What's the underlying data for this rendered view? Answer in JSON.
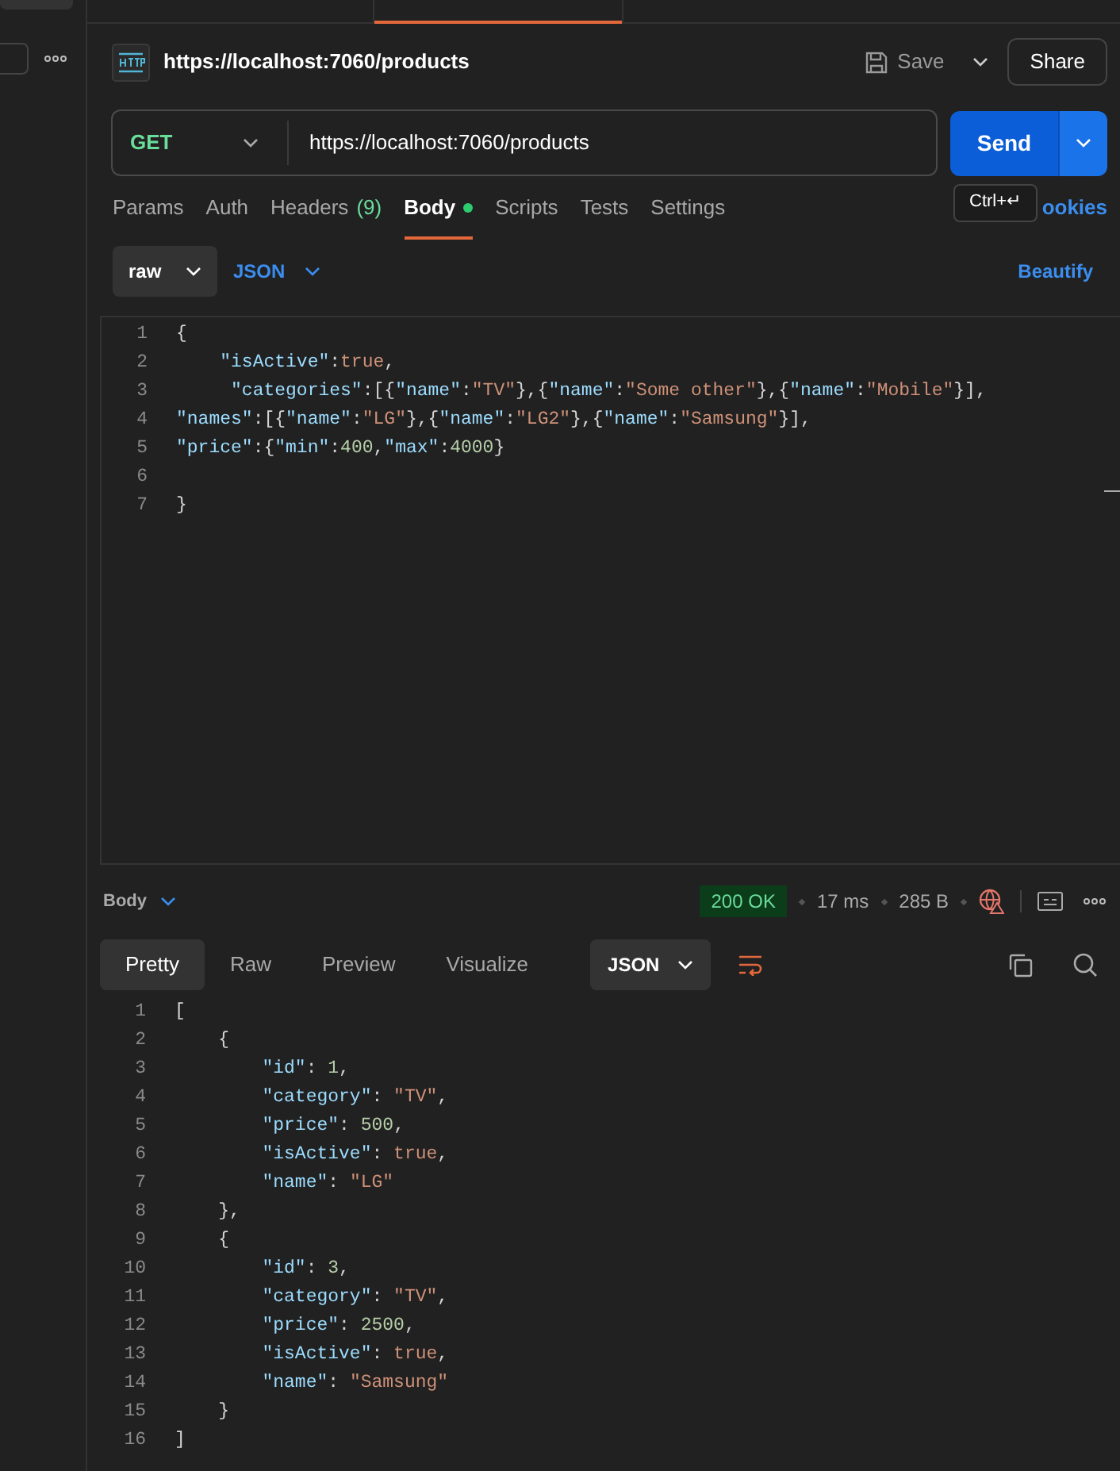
{
  "request": {
    "title": "https://localhost:7060/products",
    "save": "Save",
    "share": "Share",
    "method": "GET",
    "url": "https://localhost:7060/products",
    "send": "Send",
    "tooltip": "Ctrl+↵"
  },
  "tabs": [
    {
      "label": "Params",
      "selected": false
    },
    {
      "label": "Auth",
      "selected": false
    },
    {
      "label": "Headers",
      "count": "(9)",
      "selected": false
    },
    {
      "label": "Body",
      "selected": true,
      "modified": true
    },
    {
      "label": "Scripts",
      "selected": false
    },
    {
      "label": "Tests",
      "selected": false
    },
    {
      "label": "Settings",
      "selected": false
    }
  ],
  "cookies_link": "ookies",
  "body_mode": "raw",
  "body_language": "JSON",
  "beautify": "Beautify",
  "request_body": [
    {
      "number": "1",
      "code": "{"
    },
    {
      "number": "2",
      "code": "    \"isActive\":true,"
    },
    {
      "number": "3",
      "code": "     \"categories\":[{\"name\":\"TV\"},{\"name\":\"Some other\"},{\"name\":\"Mobile\"}],"
    },
    {
      "number": "4",
      "code": "\"names\":[{\"name\":\"LG\"},{\"name\":\"LG2\"},{\"name\":\"Samsung\"}],"
    },
    {
      "number": "5",
      "code": "\"price\":{\"min\":400,\"max\":4000}"
    },
    {
      "number": "6"
    },
    {
      "number": "7",
      "code": "}"
    }
  ],
  "response": {
    "section": "Body",
    "status": "200 OK",
    "time": "17 ms",
    "size": "285 B",
    "views": [
      {
        "label": "Pretty",
        "selected": true
      },
      {
        "label": "Raw",
        "selected": false
      },
      {
        "label": "Preview",
        "selected": false
      },
      {
        "label": "Visualize",
        "selected": false
      }
    ],
    "format": "JSON",
    "lines": [
      {
        "number": "1",
        "code": "["
      },
      {
        "number": "2",
        "code": "    {"
      },
      {
        "number": "3",
        "code": "        \"id\": 1,"
      },
      {
        "number": "4",
        "code": "        \"category\": \"TV\","
      },
      {
        "number": "5",
        "code": "        \"price\": 500,"
      },
      {
        "number": "6",
        "code": "        \"isActive\": true,"
      },
      {
        "number": "7",
        "code": "        \"name\": \"LG\""
      },
      {
        "number": "8",
        "code": "    },"
      },
      {
        "number": "9",
        "code": "    {"
      },
      {
        "number": "10",
        "code": "        \"id\": 3,"
      },
      {
        "number": "11",
        "code": "        \"category\": \"TV\","
      },
      {
        "number": "12",
        "code": "        \"price\": 2500,"
      },
      {
        "number": "13",
        "code": "        \"isActive\": true,"
      },
      {
        "number": "14",
        "code": "        \"name\": \"Samsung\""
      },
      {
        "number": "15",
        "code": "    }"
      },
      {
        "number": "16",
        "code": "]"
      }
    ]
  }
}
